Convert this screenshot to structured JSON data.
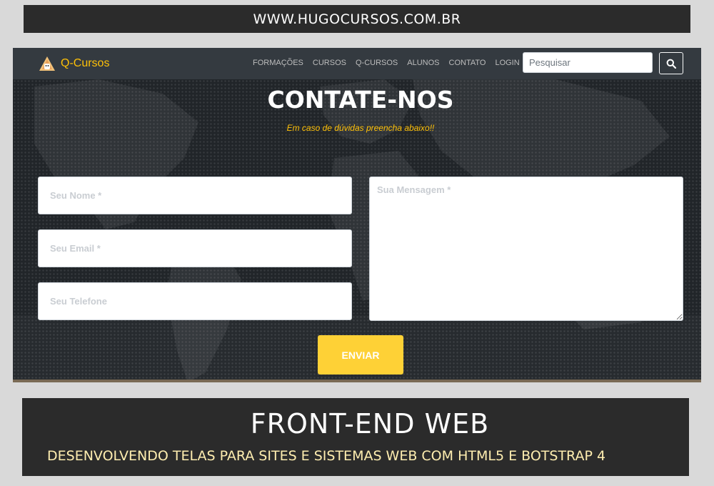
{
  "top_banner": {
    "url_text": "WWW.HUGOCURSOS.COM.BR"
  },
  "navbar": {
    "brand": "Q-Cursos",
    "links": [
      "FORMAÇÕES",
      "CURSOS",
      "Q-CURSOS",
      "ALUNOS",
      "CONTATO",
      "LOGIN"
    ],
    "search_placeholder": "Pesquisar",
    "search_icon": "search-icon"
  },
  "contact": {
    "title": "CONTATE-NOS",
    "subtitle": "Em caso de dúvidas preencha abaixo!!",
    "name_placeholder": "Seu Nome *",
    "email_placeholder": "Seu Email *",
    "phone_placeholder": "Seu Telefone",
    "message_placeholder": "Sua Mensagem *",
    "submit_label": "ENVIAR"
  },
  "bottom_banner": {
    "title": "FRONT-END WEB",
    "subtitle": "DESENVOLVENDO TELAS PARA SITES E SISTEMAS WEB COM HTML5 E BOTSTRAP 4"
  },
  "colors": {
    "accent": "#ffc107",
    "button": "#fed136",
    "navbar": "#343a40",
    "background": "#212529"
  }
}
